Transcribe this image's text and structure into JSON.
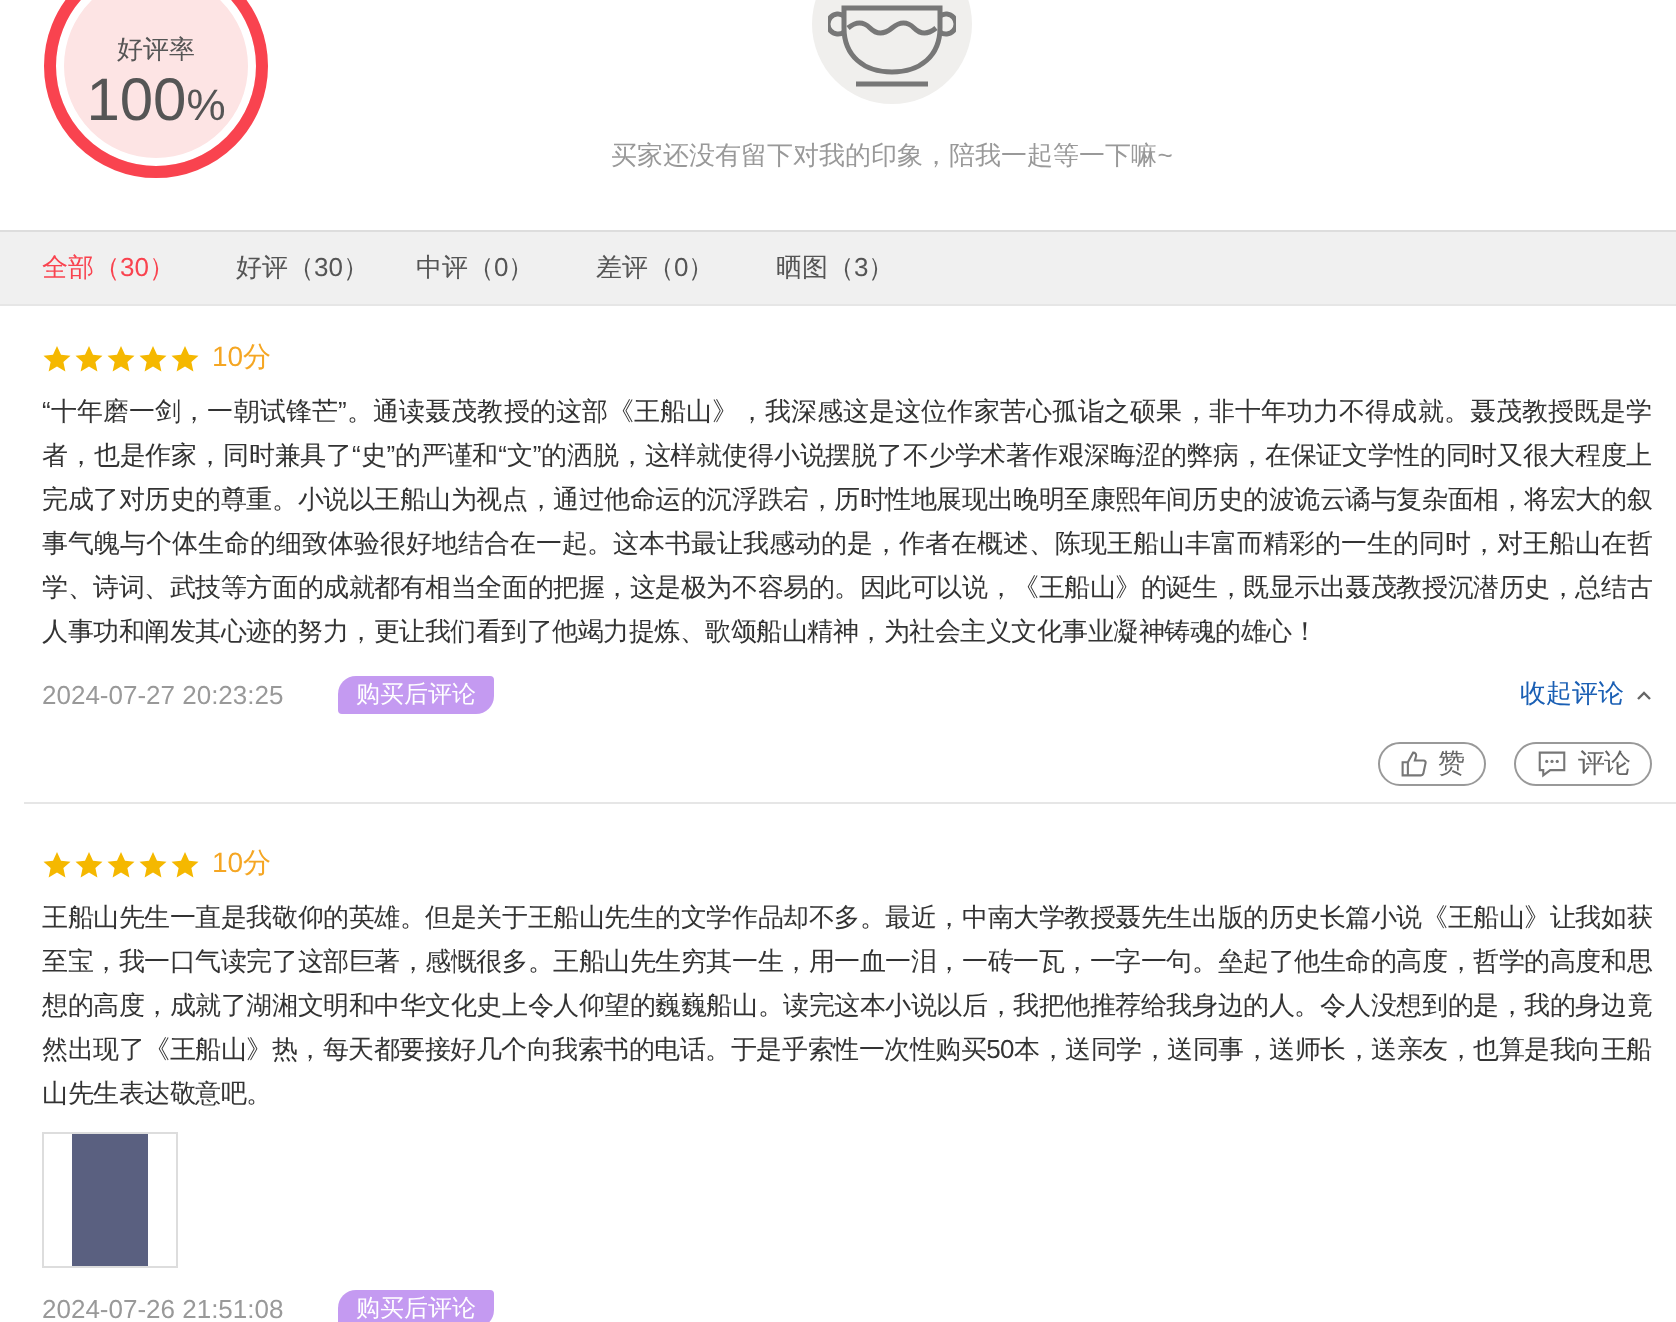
{
  "rating": {
    "label": "好评率",
    "value": "100",
    "unit": "%"
  },
  "empty_state": {
    "message": "买家还没有留下对我的印象，陪我一起等一下嘛~"
  },
  "tabs": [
    {
      "label": "全部",
      "count": "（30）",
      "selected": true
    },
    {
      "label": "好评",
      "count": "（30）",
      "selected": false
    },
    {
      "label": "中评",
      "count": "（0）",
      "selected": false
    },
    {
      "label": "差评",
      "count": "（0）",
      "selected": false
    },
    {
      "label": "晒图",
      "count": "（3）",
      "selected": false
    }
  ],
  "reviews": [
    {
      "stars": 5,
      "score": "10分",
      "text": "“十年磨一剑，一朝试锋芒”。通读聂茂教授的这部《王船山》，我深感这是这位作家苦心孤诣之硕果，非十年功力不得成就。聂茂教授既是学者，也是作家，同时兼具了“史”的严谨和“文”的洒脱，这样就使得小说摆脱了不少学术著作艰深晦涩的弊病，在保证文学性的同时又很大程度上完成了对历史的尊重。小说以王船山为视点，通过他命运的沉浮跌宕，历时性地展现出晚明至康熙年间历史的波诡云谲与复杂面相，将宏大的叙事气魄与个体生命的细致体验很好地结合在一起。这本书最让我感动的是，作者在概述、陈现王船山丰富而精彩的一生的同时，对王船山在哲学、诗词、武技等方面的成就都有相当全面的把握，这是极为不容易的。因此可以说，《王船山》的诞生，既显示出聂茂教授沉潜历史，总结古人事功和阐发其心迹的努力，更让我们看到了他竭力提炼、歌颂船山精神，为社会主义文化事业凝神铸魂的雄心！",
      "date": "2024-07-27 20:23:25",
      "badge": "购买后评论",
      "collapse": "收起评论",
      "actions": [
        "赞",
        "评论"
      ]
    },
    {
      "stars": 5,
      "score": "10分",
      "text": "王船山先生一直是我敬仰的英雄。但是关于王船山先生的文学作品却不多。最近，中南大学教授聂先生出版的历史长篇小说《王船山》让我如获至宝，我一口气读完了这部巨著，感慨很多。王船山先生穷其一生，用一血一泪，一砖一瓦，一字一句。垒起了他生命的高度，哲学的高度和思想的高度，成就了湖湘文明和中华文化史上令人仰望的巍巍船山。读完这本小说以后，我把他推荐给我身边的人。令人没想到的是，我的身边竟然出现了《王船山》热，每天都要接好几个向我索书的电话。于是乎索性一次性购买50本，送同学，送同事，送师长，送亲友，也算是我向王船山先生表达敬意吧。",
      "photos": [
        {
          "kind": "thumbnail"
        }
      ],
      "date": "2024-07-26 21:51:08",
      "badge": "购买后评论"
    }
  ]
}
